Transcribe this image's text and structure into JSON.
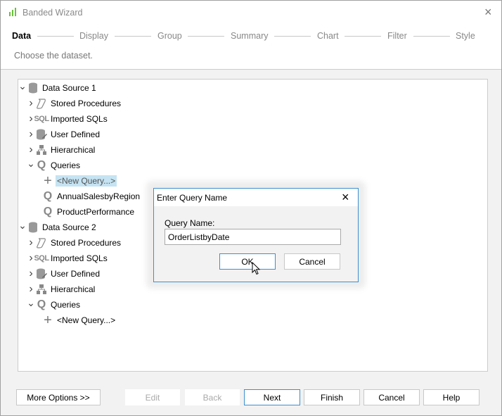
{
  "window": {
    "title": "Banded Wizard",
    "icon": "chart-bars-icon",
    "accent": "#6abf3a"
  },
  "steps": [
    "Data",
    "Display",
    "Group",
    "Summary",
    "Chart",
    "Filter",
    "Style"
  ],
  "active_step": "Data",
  "subtitle": "Choose the dataset.",
  "tree": [
    {
      "label": "Data Source 1",
      "level": 0,
      "expanded": true,
      "icon": "database-icon"
    },
    {
      "label": "Stored Procedures",
      "level": 1,
      "expanded": false,
      "icon": "scroll-icon"
    },
    {
      "label": "Imported SQLs",
      "level": 1,
      "expanded": false,
      "icon": "sql-icon"
    },
    {
      "label": "User Defined",
      "level": 1,
      "expanded": false,
      "icon": "database-edit-icon"
    },
    {
      "label": "Hierarchical",
      "level": 1,
      "expanded": false,
      "icon": "hierarchy-icon"
    },
    {
      "label": "Queries",
      "level": 1,
      "expanded": true,
      "icon": "query-icon"
    },
    {
      "label": "<New Query...>",
      "level": 2,
      "icon": "plus-icon",
      "selected": true
    },
    {
      "label": "AnnualSalesbyRegion",
      "level": 2,
      "icon": "query-icon"
    },
    {
      "label": "ProductPerformance",
      "level": 2,
      "icon": "query-icon"
    },
    {
      "label": "Data Source 2",
      "level": 0,
      "expanded": true,
      "icon": "database-icon"
    },
    {
      "label": "Stored Procedures",
      "level": 1,
      "expanded": false,
      "icon": "scroll-icon"
    },
    {
      "label": "Imported SQLs",
      "level": 1,
      "expanded": false,
      "icon": "sql-icon"
    },
    {
      "label": "User Defined",
      "level": 1,
      "expanded": false,
      "icon": "database-edit-icon"
    },
    {
      "label": "Hierarchical",
      "level": 1,
      "expanded": false,
      "icon": "hierarchy-icon"
    },
    {
      "label": "Queries",
      "level": 1,
      "expanded": true,
      "icon": "query-icon"
    },
    {
      "label": "<New Query...>",
      "level": 2,
      "icon": "plus-icon"
    }
  ],
  "dialog": {
    "title": "Enter Query Name",
    "field_label": "Query Name:",
    "field_value": "OrderListbyDate",
    "ok": "OK",
    "cancel": "Cancel",
    "close": "×"
  },
  "buttons": {
    "more_options": "More Options >>",
    "edit": "Edit",
    "back": "Back",
    "next": "Next",
    "finish": "Finish",
    "cancel": "Cancel",
    "help": "Help"
  },
  "close": "×"
}
